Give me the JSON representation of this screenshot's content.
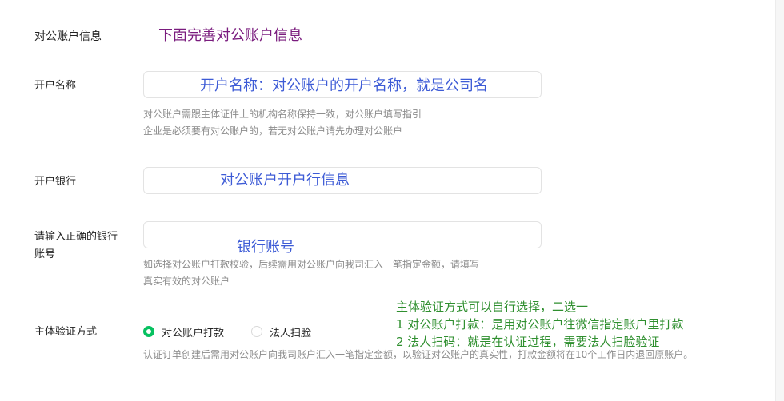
{
  "section": {
    "title": "对公账户信息",
    "annotation": "下面完善对公账户信息"
  },
  "account_name": {
    "label": "开户名称",
    "annotation": "开户名称：对公账户的开户名称，就是公司名",
    "hint_line1": "对公账户需跟主体证件上的机构名称保持一致，对公账户填写指引",
    "hint_line2": "企业是必须要有对公账户的，若无对公账户请先办理对公账户"
  },
  "bank": {
    "label": "开户银行",
    "annotation": "对公账户开户行信息"
  },
  "account_number": {
    "label_line1": "请输入正确的银行",
    "label_line2": "账号",
    "annotation": "银行账号",
    "hint_line1": "如选择对公账户打款校验，后续需用对公账户向我司汇入一笔指定金额，请填写",
    "hint_line2": "真实有效的对公账户"
  },
  "verification": {
    "label": "主体验证方式",
    "options": [
      {
        "label": "对公账户打款",
        "checked": true
      },
      {
        "label": "法人扫脸",
        "checked": false
      }
    ],
    "hint": "认证订单创建后需用对公账户向我司账户汇入一笔指定金额，以验证对公账户的真实性，打款金额将在10个工作日内退回原账户。",
    "annotation_line1": "主体验证方式可以自行选择，二选一",
    "annotation_line2": "1 对公账户打款：是用对公账户往微信指定账户里打款",
    "annotation_line3": "2 法人扫码：就是在认证过程，需要法人扫脸验证"
  },
  "colors": {
    "accent_green": "#07c160",
    "annotation_blue": "#3d5bd6",
    "annotation_purple": "#7a1c7e",
    "annotation_green": "#2f8f2f"
  }
}
